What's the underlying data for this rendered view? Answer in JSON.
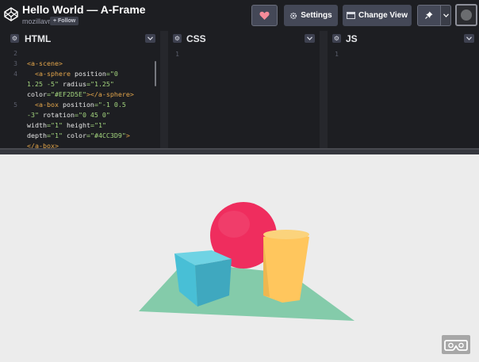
{
  "header": {
    "title": "Hello World — A-Frame",
    "author": "mozillavr",
    "follow_label": "+ Follow",
    "settings_label": "Settings",
    "change_view_label": "Change View"
  },
  "panes": {
    "html": {
      "title": "HTML",
      "line_numbers": [
        "2",
        "3",
        "4",
        "",
        "",
        "5",
        "",
        "",
        ""
      ],
      "lines": [
        [
          {
            "t": "",
            "c": ""
          }
        ],
        [
          {
            "t": "<a-scene>",
            "c": "tag"
          }
        ],
        [
          {
            "t": "  <a-sphere ",
            "c": "tag"
          },
          {
            "t": "position",
            "c": "attr"
          },
          {
            "t": "=\"0",
            "c": "str"
          }
        ],
        [
          {
            "t": "1.25 -5\" ",
            "c": "str"
          },
          {
            "t": "radius",
            "c": "attr"
          },
          {
            "t": "=\"1.25\"",
            "c": "str"
          }
        ],
        [
          {
            "t": "color",
            "c": "attr"
          },
          {
            "t": "=\"#EF2D5E\"",
            "c": "str"
          },
          {
            "t": "></a-sphere>",
            "c": "tag"
          }
        ],
        [
          {
            "t": "  <a-box ",
            "c": "tag"
          },
          {
            "t": "position",
            "c": "attr"
          },
          {
            "t": "=\"-1 0.5",
            "c": "str"
          }
        ],
        [
          {
            "t": "-3\" ",
            "c": "str"
          },
          {
            "t": "rotation",
            "c": "attr"
          },
          {
            "t": "=\"0 45 0\"",
            "c": "str"
          }
        ],
        [
          {
            "t": "width",
            "c": "attr"
          },
          {
            "t": "=\"1\" ",
            "c": "str"
          },
          {
            "t": "height",
            "c": "attr"
          },
          {
            "t": "=\"1\"",
            "c": "str"
          }
        ],
        [
          {
            "t": "depth",
            "c": "attr"
          },
          {
            "t": "=\"1\" ",
            "c": "str"
          },
          {
            "t": "color",
            "c": "attr"
          },
          {
            "t": "=\"#4CC3D9\"",
            "c": "str"
          },
          {
            "t": ">",
            "c": "tag"
          }
        ],
        [
          {
            "t": "</a-box>",
            "c": "tag"
          }
        ]
      ]
    },
    "css": {
      "title": "CSS",
      "line_numbers": [
        "1"
      ]
    },
    "js": {
      "title": "JS",
      "line_numbers": [
        "1"
      ]
    }
  },
  "scene": {
    "sphere_color": "#EF2D5E",
    "box_color": "#4CC3D9",
    "cylinder_color": "#FFC65D",
    "plane_color": "#7BC8A4",
    "sky_color": "#ECECEC"
  },
  "icons": {
    "logo": "codepen-logo-icon",
    "heart": "heart-icon",
    "settings": "gear-icon",
    "change_view": "layout-icon",
    "pin": "pin-icon",
    "vr": "vr-headset-icon"
  }
}
